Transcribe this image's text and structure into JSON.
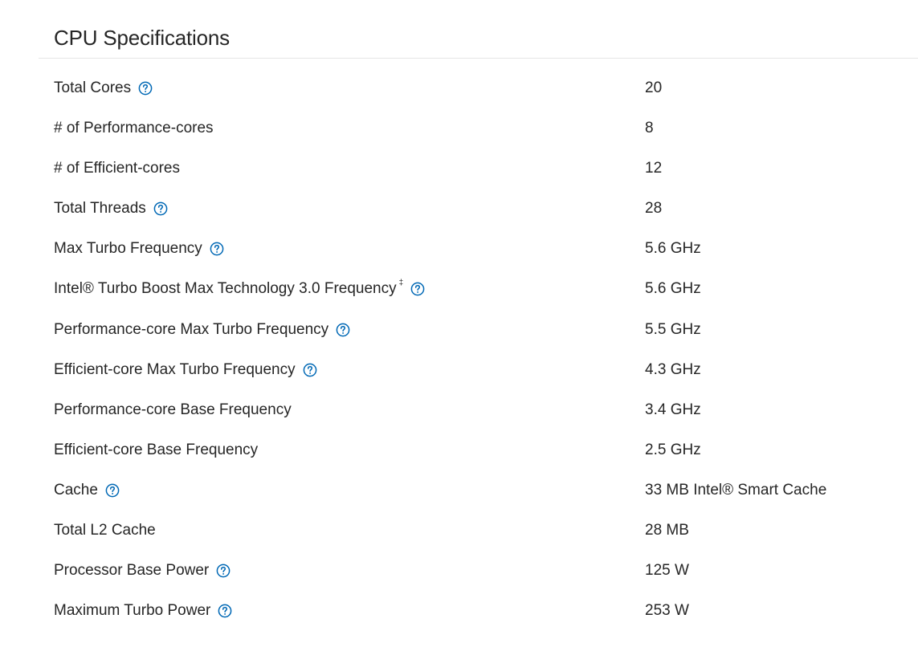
{
  "section": {
    "title": "CPU Specifications"
  },
  "colors": {
    "help_icon": "#0068b5",
    "text": "#262626",
    "divider": "#e5e5e5"
  },
  "specs": [
    {
      "label": "Total Cores",
      "value": "20",
      "help": true
    },
    {
      "label": "# of Performance-cores",
      "value": "8",
      "help": false
    },
    {
      "label": "# of Efficient-cores",
      "value": "12",
      "help": false
    },
    {
      "label": "Total Threads",
      "value": "28",
      "help": true
    },
    {
      "label": "Max Turbo Frequency",
      "value": "5.6 GHz",
      "help": true
    },
    {
      "label": "Intel® Turbo Boost Max Technology 3.0 Frequency",
      "footnote": "‡",
      "value": "5.6 GHz",
      "help": true
    },
    {
      "label": "Performance-core Max Turbo Frequency",
      "value": "5.5 GHz",
      "help": true
    },
    {
      "label": "Efficient-core Max Turbo Frequency",
      "value": "4.3 GHz",
      "help": true
    },
    {
      "label": "Performance-core Base Frequency",
      "value": "3.4 GHz",
      "help": false
    },
    {
      "label": "Efficient-core Base Frequency",
      "value": "2.5 GHz",
      "help": false
    },
    {
      "label": "Cache",
      "value": "33 MB Intel® Smart Cache",
      "help": true
    },
    {
      "label": "Total L2 Cache",
      "value": "28 MB",
      "help": false
    },
    {
      "label": "Processor Base Power",
      "value": "125 W",
      "help": true
    },
    {
      "label": "Maximum Turbo Power",
      "value": "253 W",
      "help": true
    }
  ]
}
